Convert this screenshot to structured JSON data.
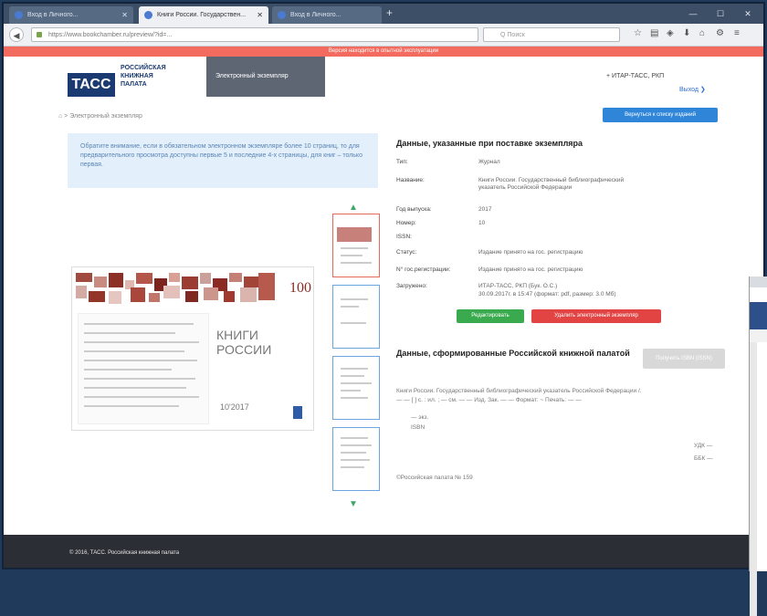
{
  "browser": {
    "tabs": [
      {
        "title": "Вход в Личного..."
      },
      {
        "title": "Книги России. Государствен..."
      },
      {
        "title": "Вход в Личного..."
      }
    ],
    "url": "https://www.bookchamber.ru/preview/?id=...",
    "search_placeholder": "Q Поиск"
  },
  "banner": "Версия находится в опытной эксплуатации",
  "header": {
    "logo": "ТАСС",
    "logo_sub": [
      "РОССИЙСКАЯ",
      "КНИЖНАЯ",
      "ПАЛАТА"
    ],
    "section_tab": "Электронный экземпляр",
    "user": "+ ИТАР-ТАСС, РКП",
    "logout": "Выход"
  },
  "breadcrumb": "Электронный экземпляр",
  "back_button": "Вернуться к списку изданий",
  "notice": "Обратите внимание, если в обязательном электронном экземпляре более 10 страниц, то для предварительного просмотра доступны первые 5 и последние 4-х страницы, для книг – только первая.",
  "preview": {
    "badge": "100",
    "title_line1": "КНИГИ",
    "title_line2": "РОССИИ",
    "issue": "10'2017"
  },
  "delivery": {
    "heading": "Данные, указанные при поставке экземпляра",
    "rows": [
      {
        "label": "Тип:",
        "value": "Журнал"
      },
      {
        "label": "Название:",
        "value": "Книги России. Государственный библиографический указатель Российской Федерации"
      },
      {
        "label": "Год выпуска:",
        "value": "2017"
      },
      {
        "label": "Номер:",
        "value": "10"
      },
      {
        "label": "ISSN:",
        "value": ""
      },
      {
        "label": "Статус:",
        "value": "Издание принято на гос. регистрацию"
      },
      {
        "label": "N° гос.регистрации:",
        "value": "Издание принято на гос. регистрацию"
      },
      {
        "label": "Загружено:",
        "value": "ИТАР-ТАСС, РКП (Бук. О.С.)"
      }
    ],
    "uploaded_detail": "30.09.2017г. в 15:47 (формат: pdf, размер: 3.0 Мб)",
    "edit_button": "Редактировать",
    "delete_button": "Удалить электронный экземпляр"
  },
  "formed": {
    "heading": "Данные, сформированные Российской книжной палатой",
    "button": "Получить ISBN (ISSN)",
    "bib_lines": [
      "Книги России. Государственный библиографический указатель Российской Федерации /.",
      "— — [ ] с. : ил. ; — см. — — Изд. Зак. — — Формат: ~ Печать: — —",
      "— экз.",
      "ISBN"
    ],
    "udk": "УДК —",
    "bbk": "ББК —",
    "copyright": "©Российская палата № 159"
  },
  "footer": "© 2016, ТАСС. Российская книжная палата"
}
